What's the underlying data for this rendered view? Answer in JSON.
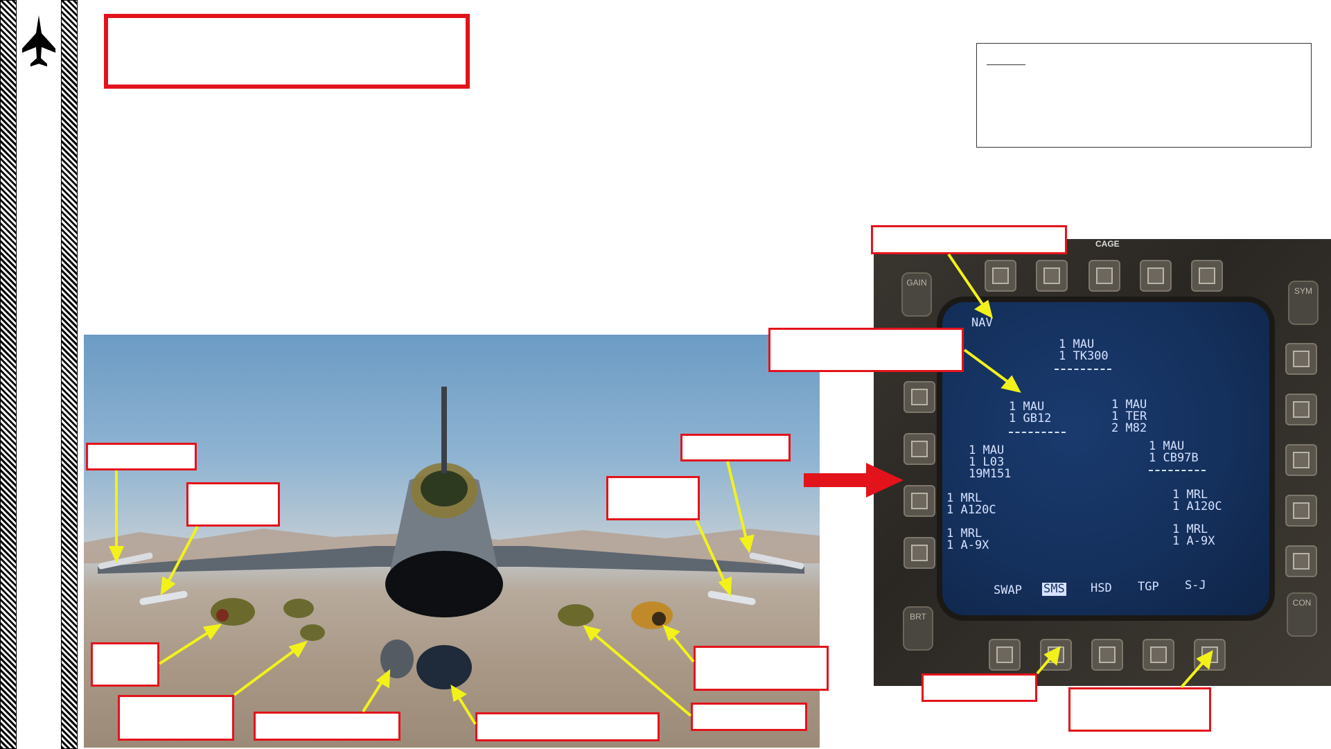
{
  "header": {
    "title_box_text": "",
    "note_box_text": ""
  },
  "mfd": {
    "top_label": "CAGE",
    "rockers": {
      "gain": "GAIN",
      "sym": "SYM",
      "brt": "BRT",
      "con": "CON"
    },
    "screen": {
      "mode": "NAV",
      "station_center_top": [
        "1 MAU",
        "1 TK300"
      ],
      "station_left_inner": [
        "1 MAU",
        "1 GB12"
      ],
      "station_right_inner": [
        "1 MAU",
        "1 TER",
        "2 M82"
      ],
      "station_left_mid": [
        "1 MAU",
        "1 L03",
        "19M151"
      ],
      "station_right_mid": [
        "1 MAU",
        "1 CB97B"
      ],
      "station_left_wing": [
        "1 MRL",
        "1 A120C"
      ],
      "station_right_wing": [
        "1 MRL",
        "1 A120C"
      ],
      "station_left_tip": [
        "1 MRL",
        "1 A-9X"
      ],
      "station_right_tip": [
        "1 MRL",
        "1 A-9X"
      ],
      "bottom_tabs": [
        "SWAP",
        "SMS",
        "HSD",
        "TGP",
        "S-J"
      ],
      "selected_tab": "SMS"
    }
  },
  "colors": {
    "callout_red": "#e3131b",
    "arrow_yellow": "#f2f21a",
    "screen_text": "#d6e2ff"
  }
}
